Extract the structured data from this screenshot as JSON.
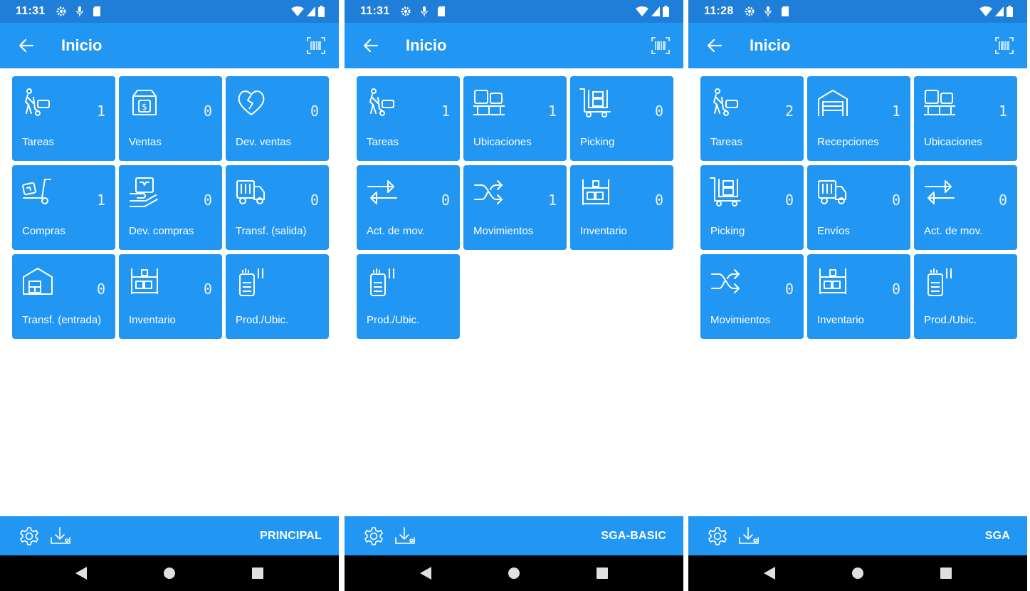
{
  "colors": {
    "status_bar": "#1f7fd8",
    "app_bar": "#2196f3",
    "tile": "#2196f3",
    "nav_bar": "#000000",
    "text": "#ffffff"
  },
  "screens": [
    {
      "status": {
        "time": "11:31"
      },
      "title": "Inicio",
      "profile": "PRINCIPAL",
      "tiles": [
        {
          "icon": "worker-trolley-icon",
          "label": "Tareas",
          "count": "1"
        },
        {
          "icon": "box-dollar-icon",
          "label": "Ventas",
          "count": "0"
        },
        {
          "icon": "broken-heart-icon",
          "label": "Dev. ventas",
          "count": "0"
        },
        {
          "icon": "hand-truck-box-icon",
          "label": "Compras",
          "count": "1"
        },
        {
          "icon": "hand-box-icon",
          "label": "Dev. compras",
          "count": "0"
        },
        {
          "icon": "delivery-truck-icon",
          "label": "Transf. (salida)",
          "count": "0"
        },
        {
          "icon": "warehouse-icon",
          "label": "Transf. (entrada)",
          "count": "0"
        },
        {
          "icon": "shelf-icon",
          "label": "Inventario",
          "count": "0"
        },
        {
          "icon": "scanner-device-icon",
          "label": "Prod./Ubic.",
          "count": ""
        }
      ]
    },
    {
      "status": {
        "time": "11:31"
      },
      "title": "Inicio",
      "profile": "SGA-BASIC",
      "tiles": [
        {
          "icon": "worker-trolley-icon",
          "label": "Tareas",
          "count": "1"
        },
        {
          "icon": "pallet-icon",
          "label": "Ubicaciones",
          "count": "1"
        },
        {
          "icon": "picking-cart-icon",
          "label": "Picking",
          "count": "0"
        },
        {
          "icon": "swap-arrows-icon",
          "label": "Act. de mov.",
          "count": "0"
        },
        {
          "icon": "shuffle-icon",
          "label": "Movimientos",
          "count": "1"
        },
        {
          "icon": "shelf-icon",
          "label": "Inventario",
          "count": "0"
        },
        {
          "icon": "scanner-device-icon",
          "label": "Prod./Ubic.",
          "count": ""
        }
      ]
    },
    {
      "status": {
        "time": "11:28"
      },
      "title": "Inicio",
      "profile": "SGA",
      "tiles": [
        {
          "icon": "worker-trolley-icon",
          "label": "Tareas",
          "count": "2"
        },
        {
          "icon": "garage-icon",
          "label": "Recepciones",
          "count": "1"
        },
        {
          "icon": "pallet-icon",
          "label": "Ubicaciones",
          "count": "1"
        },
        {
          "icon": "picking-cart-icon",
          "label": "Picking",
          "count": "0"
        },
        {
          "icon": "delivery-truck-icon",
          "label": "Envíos",
          "count": "0"
        },
        {
          "icon": "swap-arrows-icon",
          "label": "Act. de mov.",
          "count": "0"
        },
        {
          "icon": "shuffle-icon",
          "label": "Movimientos",
          "count": "0"
        },
        {
          "icon": "shelf-icon",
          "label": "Inventario",
          "count": "0"
        },
        {
          "icon": "scanner-device-icon",
          "label": "Prod./Ubic.",
          "count": ""
        }
      ]
    }
  ]
}
